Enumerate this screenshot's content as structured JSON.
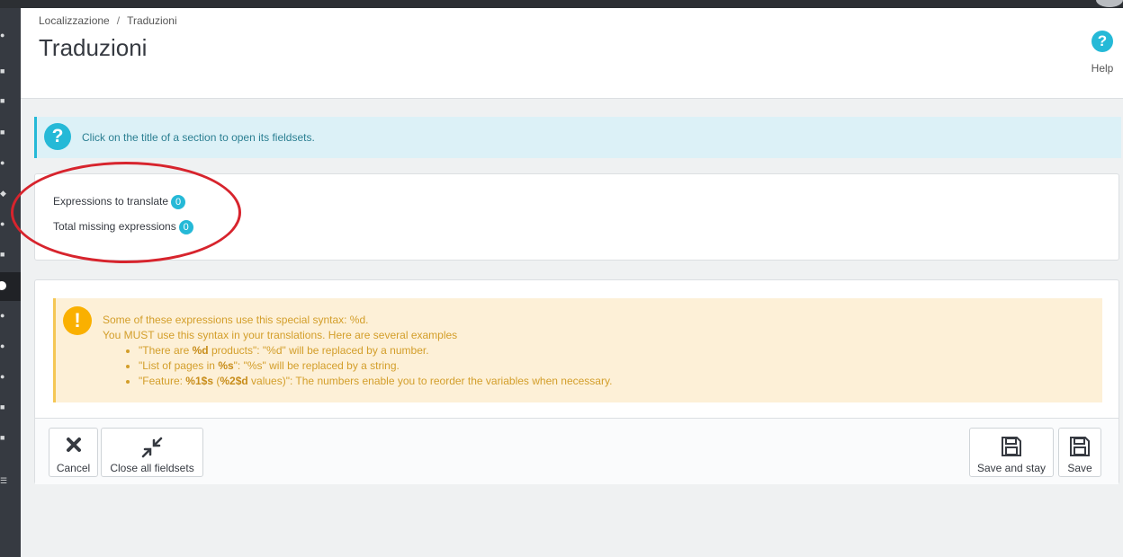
{
  "breadcrumb": {
    "parent": "Localizzazione",
    "separator": "/",
    "current": "Traduzioni"
  },
  "page": {
    "title": "Traduzioni"
  },
  "help": {
    "label": "Help",
    "icon": "question-circle-icon"
  },
  "info_alert": {
    "icon": "question-circle-icon",
    "text": "Click on the title of a section to open its fieldsets."
  },
  "stats": {
    "to_translate_label": "Expressions to translate",
    "to_translate_count": "0",
    "missing_label": "Total missing expressions",
    "missing_count": "0"
  },
  "warning": {
    "icon": "exclamation-circle-icon",
    "line1": "Some of these expressions use this special syntax: %d.",
    "line2": "You MUST use this syntax in your translations. Here are several examples",
    "examples": [
      {
        "pre": "\"There are ",
        "code": "%d",
        "post": " products\": \"%d\" will be replaced by a number."
      },
      {
        "pre": "\"List of pages in ",
        "code": "%s",
        "post": "\": \"%s\" will be replaced by a string."
      },
      {
        "pre": "\"Feature: ",
        "code": "%1$s",
        "mid": " (",
        "code2": "%2$d",
        "post": " values)\": The numbers enable you to reorder the variables when necessary."
      }
    ]
  },
  "buttons": {
    "cancel": "Cancel",
    "close_all": "Close all fieldsets",
    "save_and_stay": "Save and stay",
    "save": "Save"
  },
  "colors": {
    "accent": "#25b9d7",
    "warning_bg": "#fdf0d7",
    "warning_text": "#d39e2a",
    "annotation": "#d7242d",
    "sidebar": "#363a41"
  }
}
